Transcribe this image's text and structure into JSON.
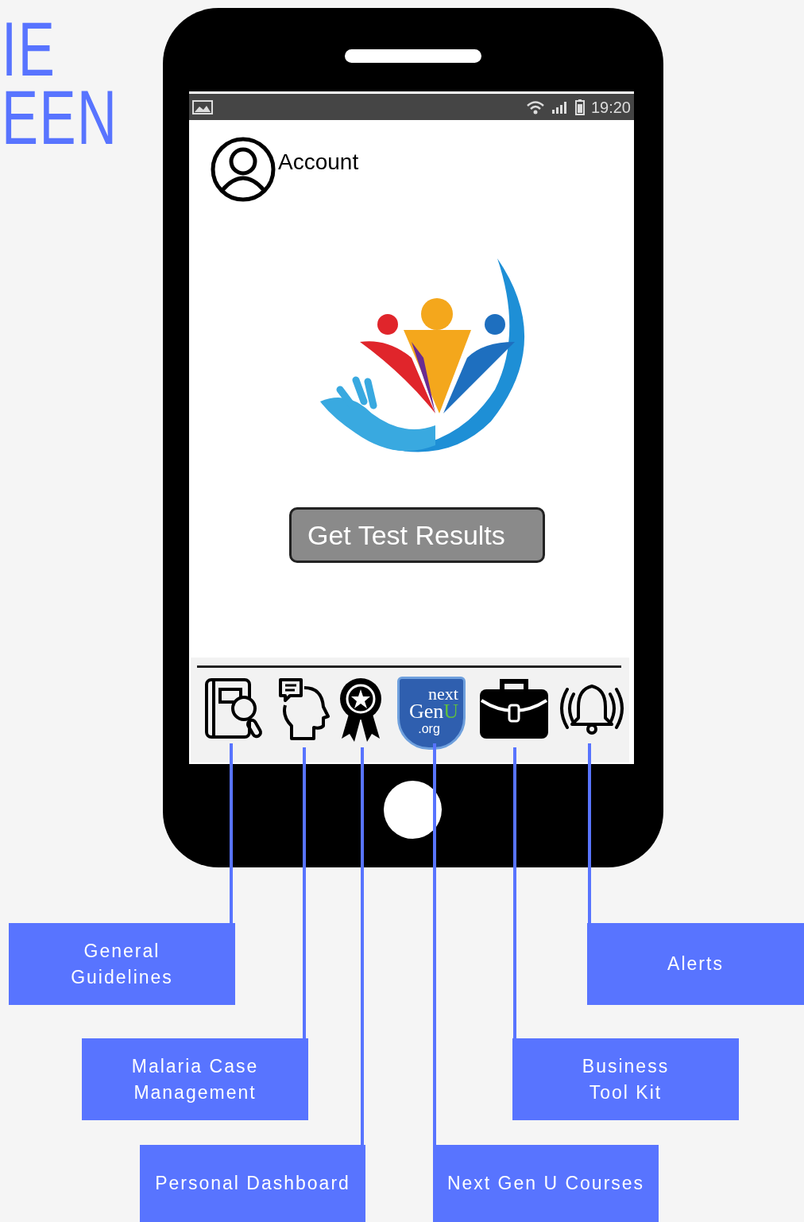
{
  "heading_lines": [
    "IE",
    "EEN"
  ],
  "status_bar": {
    "time": "19:20"
  },
  "account": {
    "label": "Account"
  },
  "action_button": {
    "label": "Get Test Results"
  },
  "nav_icons": [
    {
      "kind": "guide",
      "callout": [
        "General",
        "Guidelines"
      ]
    },
    {
      "kind": "head",
      "callout": [
        "Malaria Case",
        "Management"
      ]
    },
    {
      "kind": "award",
      "callout": [
        "Personal Dashboard"
      ]
    },
    {
      "kind": "badge",
      "badge_text": {
        "top": "next",
        "mid": "Gen",
        "accent": "U",
        "bottom": ".org"
      },
      "callout": [
        "Next Gen U Courses"
      ]
    },
    {
      "kind": "briefcase",
      "callout": [
        "Business",
        "Tool Kit"
      ]
    },
    {
      "kind": "bell",
      "callout": [
        "Alerts"
      ]
    }
  ]
}
